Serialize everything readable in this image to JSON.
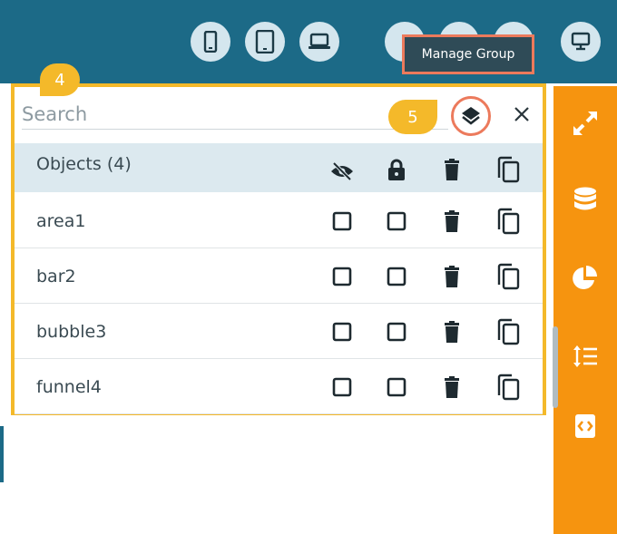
{
  "toolbar": {
    "devices": [
      "mobile-portrait-icon",
      "tablet-icon",
      "laptop-icon",
      "desktop-icon"
    ],
    "tooltip": "Manage Group"
  },
  "panel": {
    "step_badge": "4",
    "search_placeholder": "Search",
    "layers_step_badge": "5",
    "header_label": "Objects (4)",
    "rows": [
      {
        "label": "area1"
      },
      {
        "label": "bar2"
      },
      {
        "label": "bubble3"
      },
      {
        "label": "funnel4"
      }
    ]
  },
  "sidebar": {
    "icons": [
      "expand-icon",
      "database-icon",
      "pie-chart-icon",
      "line-height-icon",
      "code-icon"
    ]
  },
  "colors": {
    "topbar": "#1c6a87",
    "sidebar": "#f6940f",
    "highlight_border": "#f4b92a",
    "focus_ring": "#ec7a5c"
  }
}
